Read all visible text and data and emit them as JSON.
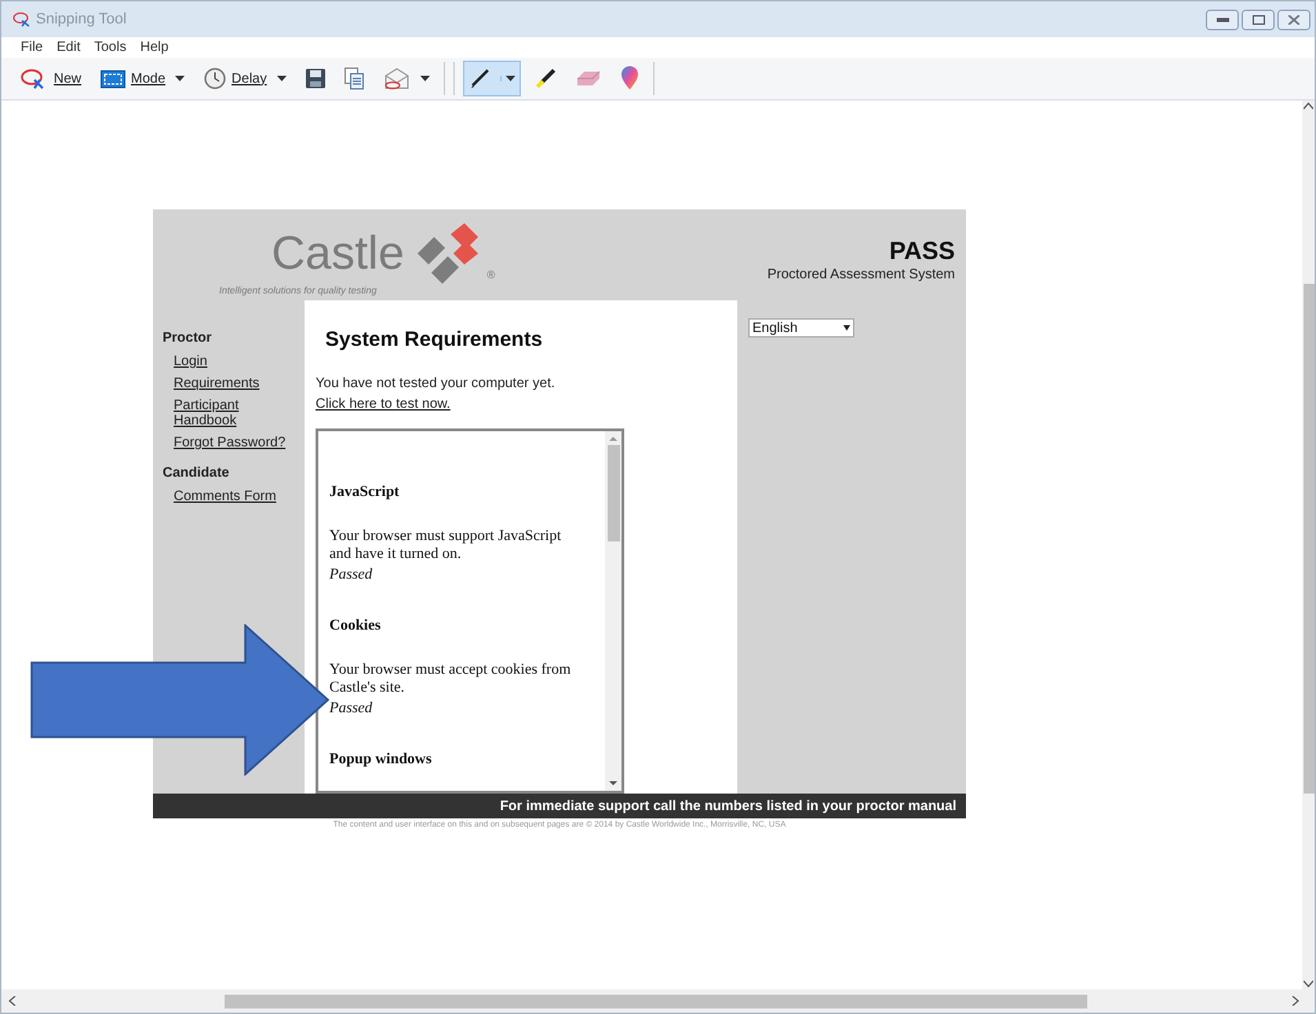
{
  "window": {
    "title": "Snipping Tool"
  },
  "menu": [
    "File",
    "Edit",
    "Tools",
    "Help"
  ],
  "toolbar": [
    {
      "kind": "new",
      "label": "New",
      "dropdown": false,
      "selected": false
    },
    {
      "kind": "mode",
      "label": "Mode",
      "dropdown": true,
      "selected": false
    },
    {
      "kind": "delay",
      "label": "Delay",
      "dropdown": true,
      "selected": false
    },
    {
      "kind": "save",
      "dropdown": false,
      "selected": false
    },
    {
      "kind": "copy",
      "dropdown": false,
      "selected": false
    },
    {
      "kind": "send",
      "dropdown": true,
      "selected": false
    },
    {
      "kind": "pen",
      "dropdown": true,
      "selected": true
    },
    {
      "kind": "highlighter",
      "dropdown": false,
      "selected": false
    },
    {
      "kind": "eraser",
      "dropdown": false,
      "selected": false
    },
    {
      "kind": "paint",
      "dropdown": false,
      "selected": false
    }
  ],
  "page": {
    "logo": {
      "name": "Castle",
      "mark": "®",
      "tagline": "Intelligent solutions for quality testing"
    },
    "product": {
      "name": "PASS",
      "subtitle": "Proctored Assessment System"
    },
    "nav": [
      {
        "heading": "Proctor",
        "links": [
          "Login",
          "Requirements",
          "Participant Handbook",
          "Forgot Password?"
        ]
      },
      {
        "heading": "Candidate",
        "links": [
          "Comments Form"
        ]
      }
    ],
    "title": "System Requirements",
    "status": "You have not tested your computer yet.",
    "test_link": "Click here to test now.",
    "requirements": [
      {
        "name": "JavaScript",
        "text": "Your browser must support JavaScript and have it turned on.",
        "result": "Passed"
      },
      {
        "name": "Cookies",
        "text": "Your browser must accept cookies from Castle's site.",
        "result": "Passed"
      },
      {
        "name": "Popup windows"
      }
    ],
    "language": "English",
    "support": "For immediate support call the numbers listed in your proctor manual",
    "copyright": "The content and user interface on this and on subsequent pages are © 2014 by Castle Worldwide Inc., Morrisville, NC, USA"
  }
}
